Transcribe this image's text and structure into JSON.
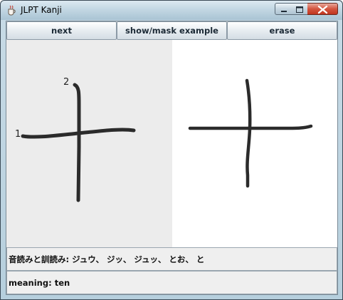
{
  "window": {
    "title": "JLPT Kanji",
    "icon": "java-cup-icon",
    "controls": [
      "minimize",
      "maximize",
      "close"
    ]
  },
  "toolbar": {
    "next_label": "next",
    "show_mask_label": "show/mask example",
    "erase_label": "erase"
  },
  "drawing": {
    "stroke_numbers": [
      "1",
      "2"
    ]
  },
  "info": {
    "readings": "音読みと訓読み: ジュウ、 ジッ、 ジュッ、 とお、 と",
    "meaning": "meaning: ten"
  },
  "colors": {
    "stroke": "#2b2b2b",
    "left_canvas_bg": "#ececec",
    "right_canvas_bg": "#ffffff"
  }
}
